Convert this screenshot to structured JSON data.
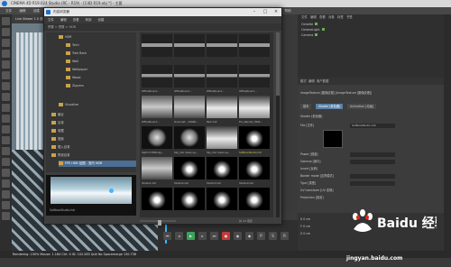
{
  "app": {
    "title": "CINEMA 4D R19.024 Studio (RC - R19) - [C4D R19.obj *] - 主要"
  },
  "menubar": [
    "文件",
    "编辑",
    "创建",
    "模式",
    "选择",
    "工具",
    "网格",
    "捕捉",
    "动画",
    "模拟",
    "渲染",
    "雕刻",
    "运动跟踪",
    "运动图形",
    "角色",
    "流水线",
    "插件",
    "脚本",
    "窗口",
    "帮助"
  ],
  "viewport": {
    "header": "Live Viewer 1.0  查看  摄像机  显示  选项  过滤  面板"
  },
  "status_bar": {
    "text": "Rendering: 100%  Mouse: 1.184  Ctrl: 0  ID: 102.283  Quit  No  Spacemarge  130.738"
  },
  "timeline": {
    "ruler": "0  10  20  30  40  50  60  70  80  90",
    "frame": "0 F"
  },
  "content_browser": {
    "title": "内容浏览器",
    "menu": [
      "文件",
      "编辑",
      "查看",
      "转到",
      "创建"
    ],
    "path": "预置 > 预置 > HDR",
    "tree": [
      {
        "label": "HDR",
        "indent": 0,
        "selected": false
      },
      {
        "label": "Tech",
        "indent": 1,
        "selected": false
      },
      {
        "label": "Tree Bark",
        "indent": 1,
        "selected": false
      },
      {
        "label": "Wall",
        "indent": 1,
        "selected": false
      },
      {
        "label": "Wallpaper",
        "indent": 1,
        "selected": false
      },
      {
        "label": "Wood",
        "indent": 1,
        "selected": false
      },
      {
        "label": "Zippers",
        "indent": 1,
        "selected": false
      },
      {
        "label": "Visualize",
        "indent": 0,
        "selected": false
      },
      {
        "label": "最近",
        "indent": 0,
        "selected": false
      },
      {
        "label": "目录",
        "indent": 0,
        "selected": false
      },
      {
        "label": "收藏",
        "indent": 0,
        "selected": false
      },
      {
        "label": "搜索",
        "indent": 0,
        "selected": false
      },
      {
        "label": "载入目录",
        "indent": 0,
        "selected": false
      },
      {
        "label": "预设目录",
        "indent": 0,
        "selected": false
      },
      {
        "label": "FPS HDR 贴图 - 室内 HDR",
        "indent": 1,
        "selected": true
      }
    ],
    "preview_label": "SoftboxStudio.hdr",
    "thumbnails": [
      {
        "label": "",
        "style": "bar"
      },
      {
        "label": "",
        "style": "bar"
      },
      {
        "label": "",
        "style": "bar"
      },
      {
        "label": "",
        "style": "bar"
      },
      {
        "label": "OfficeRound...",
        "style": "bar"
      },
      {
        "label": "OfficeRound...",
        "style": "bar"
      },
      {
        "label": "OfficeRound...",
        "style": "bar"
      },
      {
        "label": "OfficeRound...",
        "style": "bar"
      },
      {
        "label": "OfficeRound...",
        "style": "room"
      },
      {
        "label": "Overcast - 1000K...",
        "style": "room"
      },
      {
        "label": "Park.hdr",
        "style": "hdr"
      },
      {
        "label": "Pro_Render_HDR...",
        "style": "hdr"
      },
      {
        "label": "Splitch HDR.sky...",
        "style": "sphere"
      },
      {
        "label": "Sky_CIA mean.sy...",
        "style": "sphere"
      },
      {
        "label": "Sky_CIA mean.sy...",
        "style": "hdr"
      },
      {
        "label": "SoftboxStudio.hdr",
        "style": "light",
        "selected": true
      },
      {
        "label": "Studio1.hdr",
        "style": "room"
      },
      {
        "label": "Studio2.hdr",
        "style": "light"
      },
      {
        "label": "Studio3.hdr",
        "style": "light"
      },
      {
        "label": "Studio4.hdr",
        "style": "light"
      },
      {
        "label": "",
        "style": "light"
      },
      {
        "label": "",
        "style": "light"
      },
      {
        "label": "",
        "style": "light"
      },
      {
        "label": "",
        "style": "light"
      }
    ],
    "status": "共 24 项目"
  },
  "object_manager": {
    "tabs": [
      "文件",
      "编辑",
      "查看",
      "对象",
      "标签",
      "书签"
    ],
    "rows": [
      "Octalite",
      "OctaneLight",
      "Camera"
    ]
  },
  "attribute_manager": {
    "tabs": [
      "模式",
      "编辑",
      "用户数据"
    ],
    "object_title": "ImageTexture [图像纹理] [ImageTexture [图像纹理]]",
    "subtabs": [
      "基本",
      "Shader [着色器]",
      "Animation [动画]"
    ],
    "rows": [
      "Shader [着色器]",
      "File [文件]",
      "Power [强度]",
      "Gamma [伽马]",
      "Invert [反转]",
      "Border mode [边界模式]",
      "Type [类型]",
      "UV transform [UV 变换]",
      "Projection [投射]"
    ],
    "file_value": "SoftboxStudio.hdr"
  },
  "coord_panel": {
    "rows": [
      "X  0 cm",
      "Y  0 cm",
      "Z  0 cm"
    ]
  },
  "watermark": {
    "brand": "Baidu 经验",
    "url": "jingyan.baidu.com"
  }
}
